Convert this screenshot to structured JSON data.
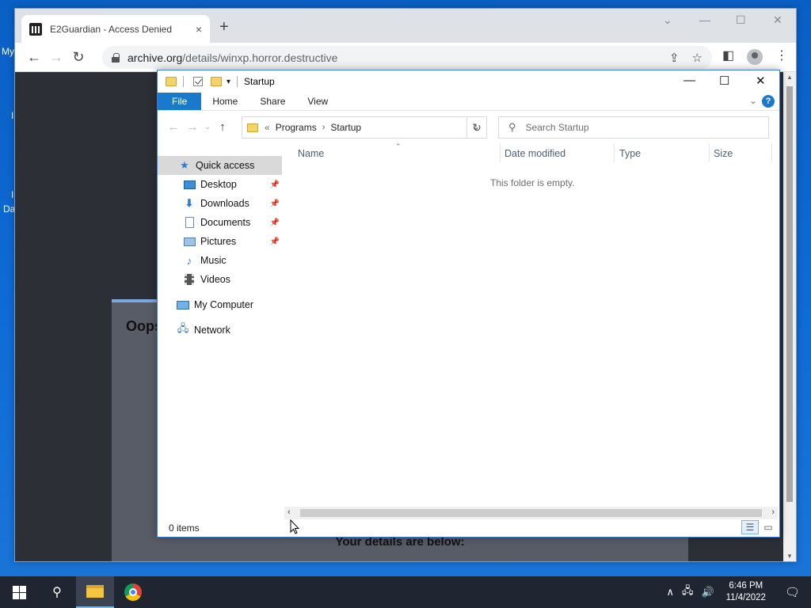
{
  "desktop": {
    "fragments": [
      "My",
      "I",
      "I",
      "Da"
    ]
  },
  "browser": {
    "tab_title": "E2Guardian - Access Denied",
    "tab_close": "×",
    "new_tab": "+",
    "url_host": "archive.org",
    "url_path": "/details/winxp.horror.destructive",
    "page": {
      "heading": "Oops",
      "details": "Your details are below:"
    }
  },
  "explorer": {
    "title": "Startup",
    "ribbon_tabs": [
      "File",
      "Home",
      "Share",
      "View"
    ],
    "help": "?",
    "address": [
      "«",
      "Programs",
      "Startup"
    ],
    "search_placeholder": "Search Startup",
    "nav": {
      "quick_access": "Quick access",
      "items": [
        "Desktop",
        "Downloads",
        "Documents",
        "Pictures",
        "Music",
        "Videos"
      ],
      "my_computer": "My Computer",
      "network": "Network"
    },
    "columns": [
      "Name",
      "Date modified",
      "Type",
      "Size"
    ],
    "empty_message": "This folder is empty.",
    "status": "0 items"
  },
  "taskbar": {
    "time": "6:46 PM",
    "date": "11/4/2022"
  }
}
